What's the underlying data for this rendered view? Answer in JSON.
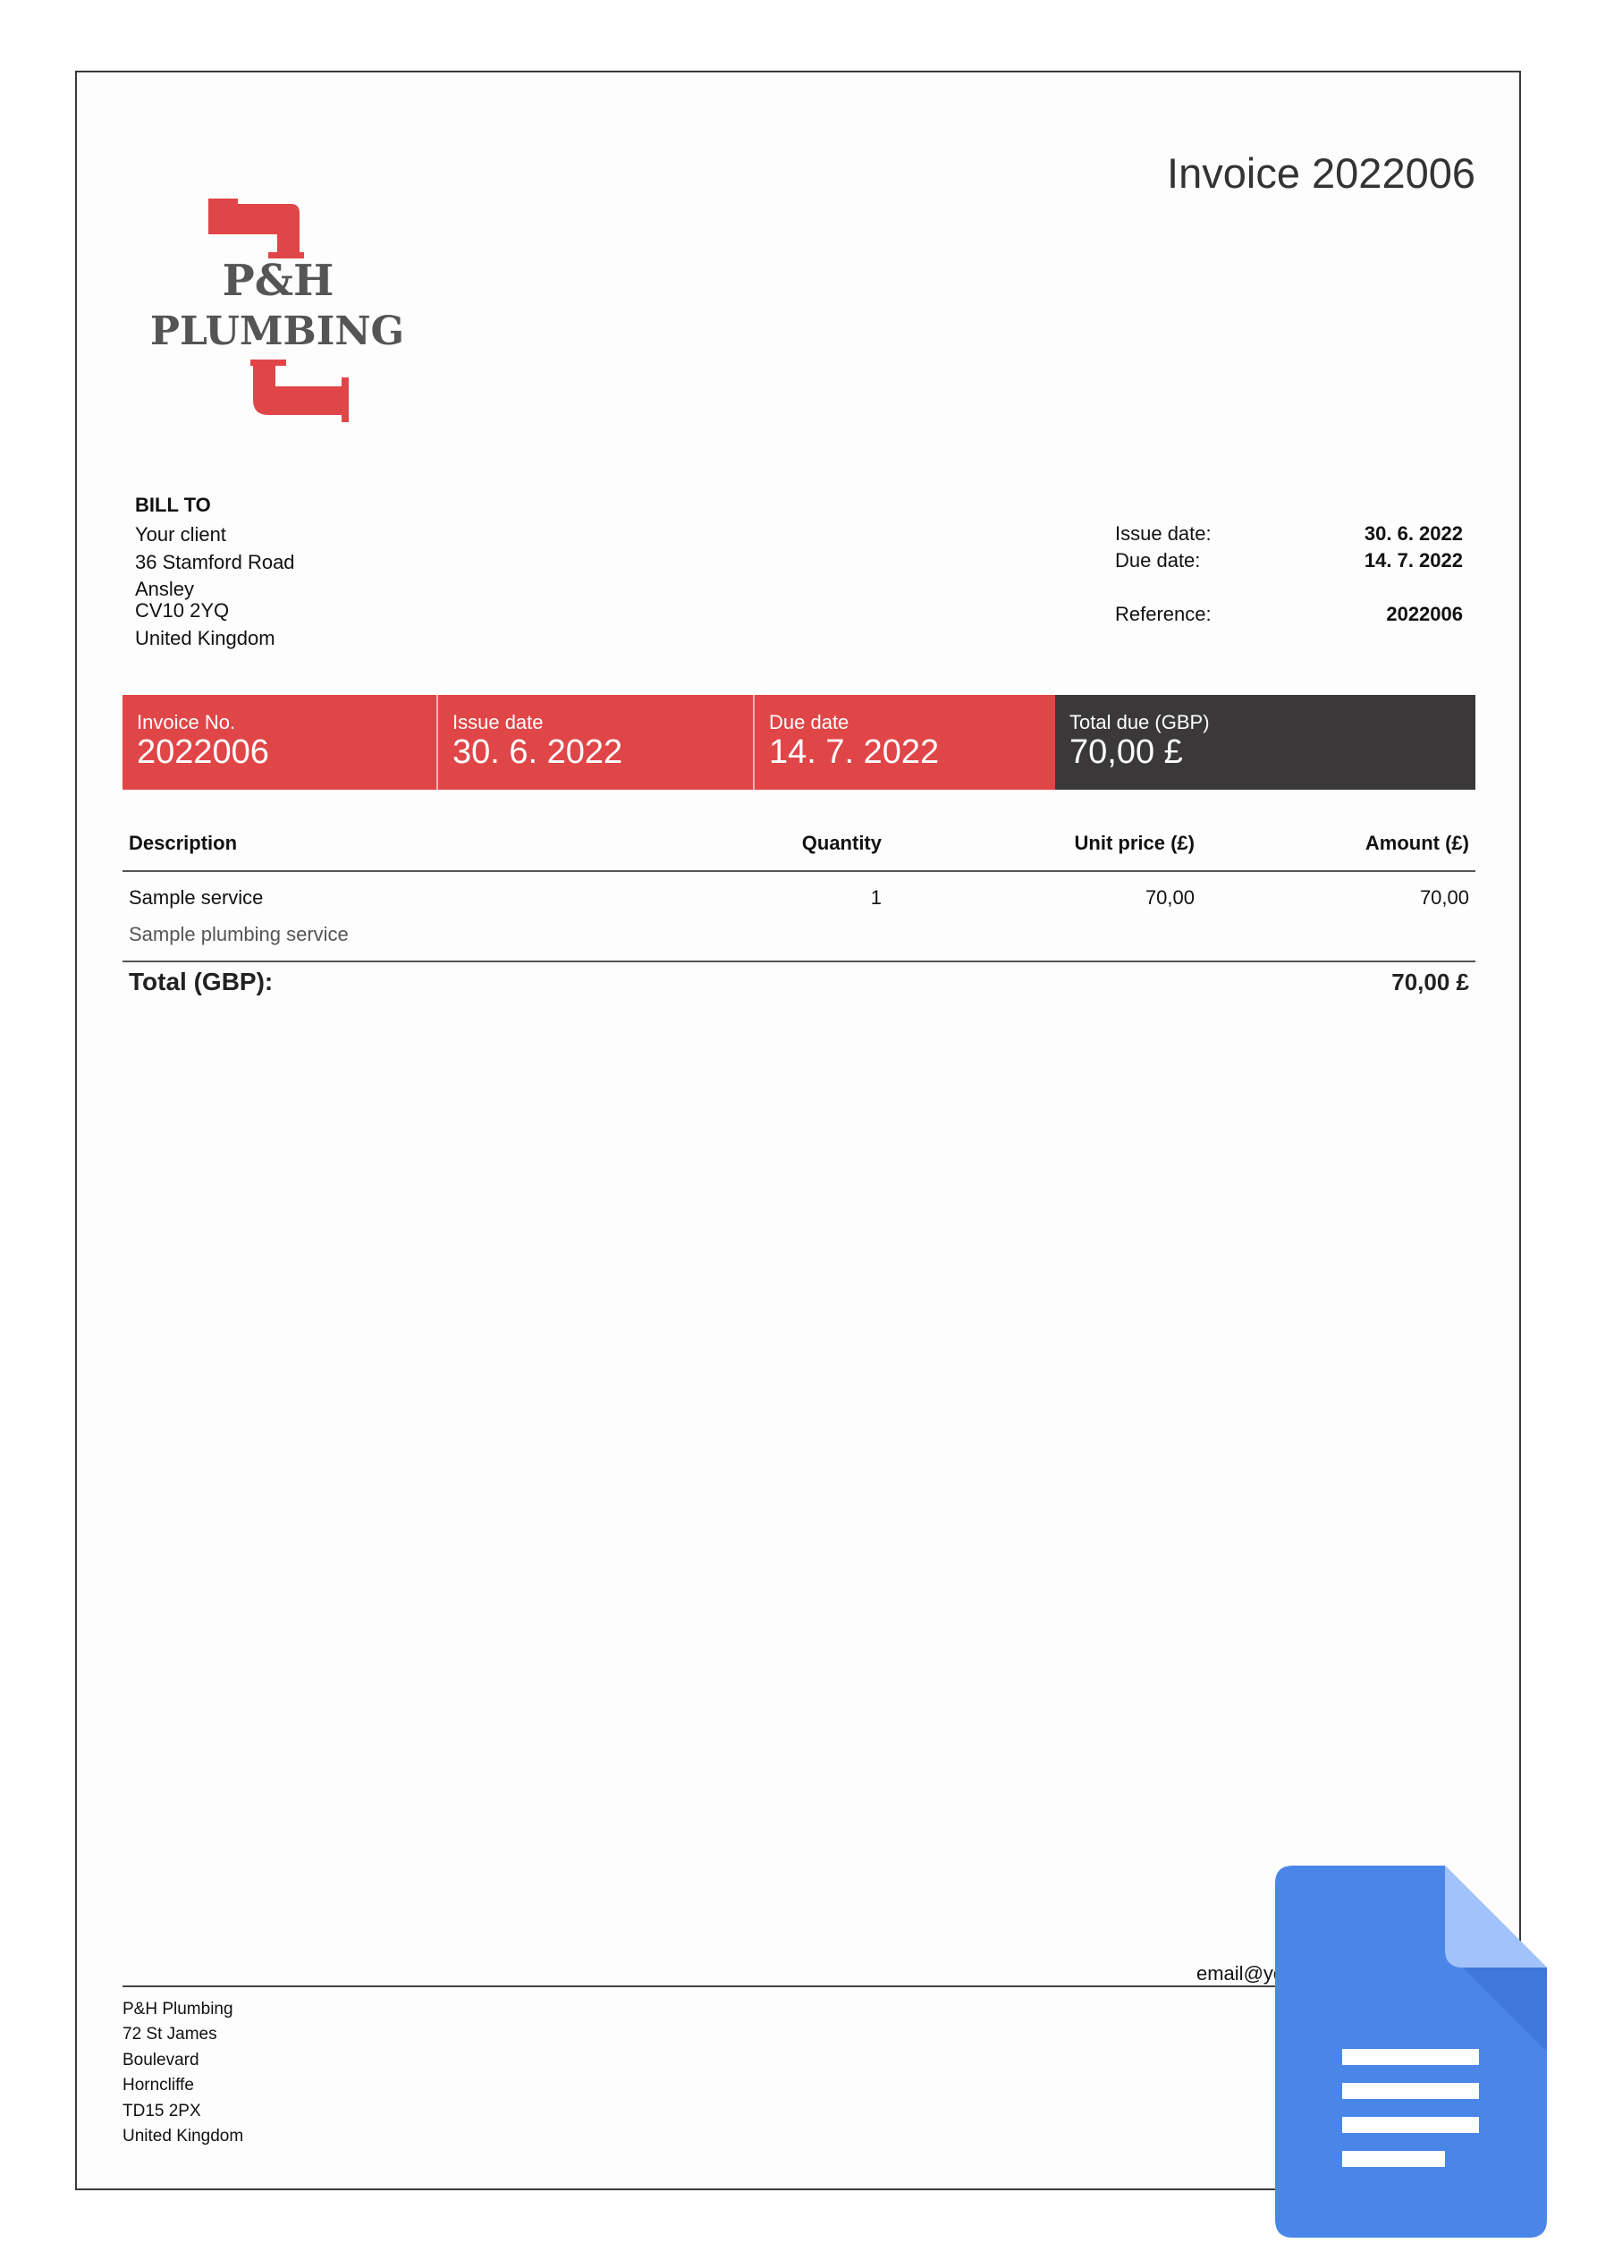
{
  "document": {
    "title": "Invoice 2022006"
  },
  "logo": {
    "line1": "P&H",
    "line2": "PLUMBING",
    "pipe_color": "#e04648",
    "text_color": "#555555"
  },
  "bill_to": {
    "heading": "BILL TO",
    "lines": [
      "Your client",
      "36 Stamford Road",
      "Ansley",
      "CV10 2YQ",
      "United Kingdom"
    ]
  },
  "meta": {
    "issue_date_label": "Issue date:",
    "issue_date": "30. 6. 2022",
    "due_date_label": "Due date:",
    "due_date": "14. 7. 2022",
    "reference_label": "Reference:",
    "reference": "2022006"
  },
  "summary": {
    "invoice_no_label": "Invoice No.",
    "invoice_no": "2022006",
    "issue_date_label": "Issue date",
    "issue_date": "30. 6. 2022",
    "due_date_label": "Due date",
    "due_date": "14. 7. 2022",
    "total_label": "Total due (GBP)",
    "total": "70,00 £",
    "accent_color": "#e04648",
    "dark_color": "#3a3839"
  },
  "table": {
    "headers": {
      "description": "Description",
      "quantity": "Quantity",
      "unit_price": "Unit price (£)",
      "amount": "Amount (£)"
    },
    "rows": [
      {
        "description": "Sample service",
        "detail": "Sample plumbing service",
        "quantity": "1",
        "unit_price": "70,00",
        "amount": "70,00"
      }
    ],
    "total_label": "Total (GBP):",
    "total_value": "70,00 £"
  },
  "footer": {
    "company_lines": [
      "P&H Plumbing",
      "72 St James",
      "Boulevard",
      "Horncliffe",
      "TD15 2PX",
      "United Kingdom"
    ],
    "email": "email@yo"
  },
  "overlay": {
    "icon": "google-docs-icon",
    "icon_color": "#4a86e8"
  }
}
